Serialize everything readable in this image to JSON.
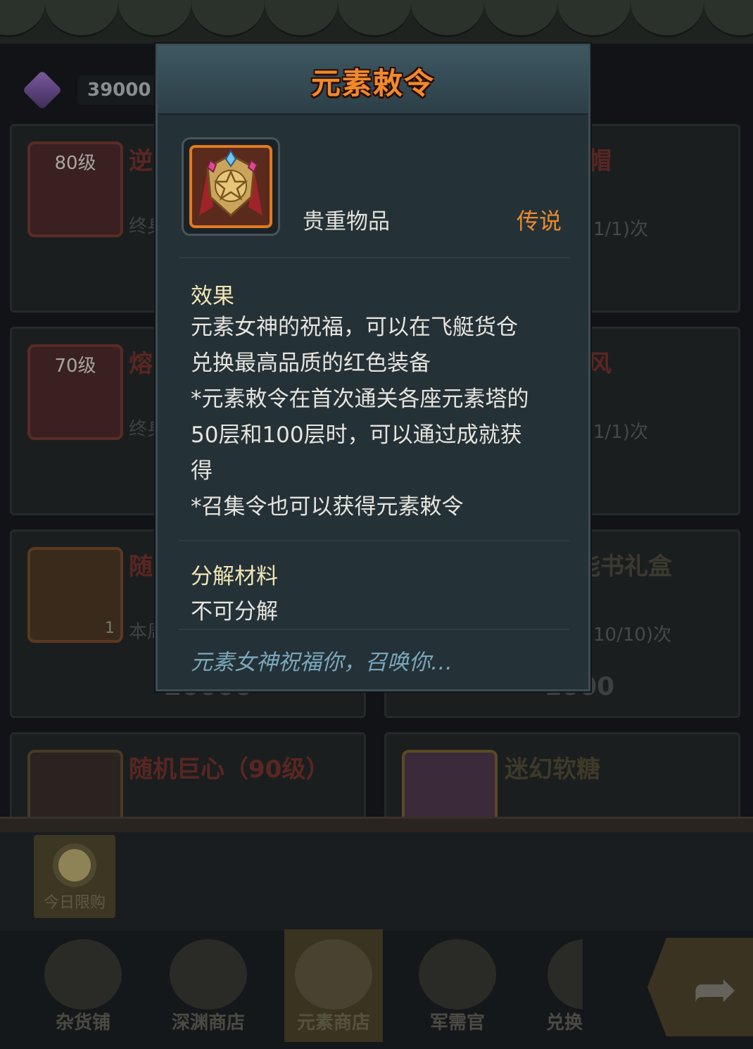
{
  "currency": {
    "icon": "crystal-gem-icon",
    "amount": "39000"
  },
  "cards": [
    {
      "level_badge": "80级",
      "title_partial": "逆",
      "limit_partial": "终身",
      "title_right": "帽",
      "limit_right": "1/1)次"
    },
    {
      "level_badge": "70级",
      "title_partial": "熔",
      "limit_partial": "终身",
      "title_right": "风",
      "limit_right": "1/1)次"
    },
    {
      "icon_badge_count": "1",
      "title_partial": "随",
      "limit_partial": "本周",
      "title_right": "随机技能书礼盒",
      "limit_right": "10/10)次",
      "price_left": "20000",
      "price_right": "1000"
    },
    {
      "title": "随机巨心（90级）",
      "title_right": "迷幻软糖"
    }
  ],
  "today_limit_label": "今日限购",
  "tabs": [
    {
      "label": "杂货铺",
      "icon": "coins-icon"
    },
    {
      "label": "深渊商店",
      "icon": "crates-icon"
    },
    {
      "label": "元素商店",
      "icon": "element-star-icon",
      "active": true
    },
    {
      "label": "军需官",
      "icon": "helmet-icon"
    },
    {
      "label": "兑换",
      "icon": "exchange-icon"
    }
  ],
  "next_button_icon": "arrow-forward-icon",
  "popup": {
    "title": "元素敕令",
    "item_icon": "element-decree-emblem-icon",
    "item_type": "贵重物品",
    "rarity": "传说",
    "rarity_color": "#e98a2e",
    "effect_heading": "效果",
    "effect_lines": [
      "元素女神的祝福，可以在飞艇货仓",
      "兑换最高品质的红色装备",
      "*元素敕令在首次通关各座元素塔的",
      "50层和100层时，可以通过成就获",
      "得",
      "*召集令也可以获得元素敕令"
    ],
    "decompose_heading": "分解材料",
    "decompose_value": "不可分解",
    "flavor_text": "元素女神祝福你，召唤你…"
  }
}
